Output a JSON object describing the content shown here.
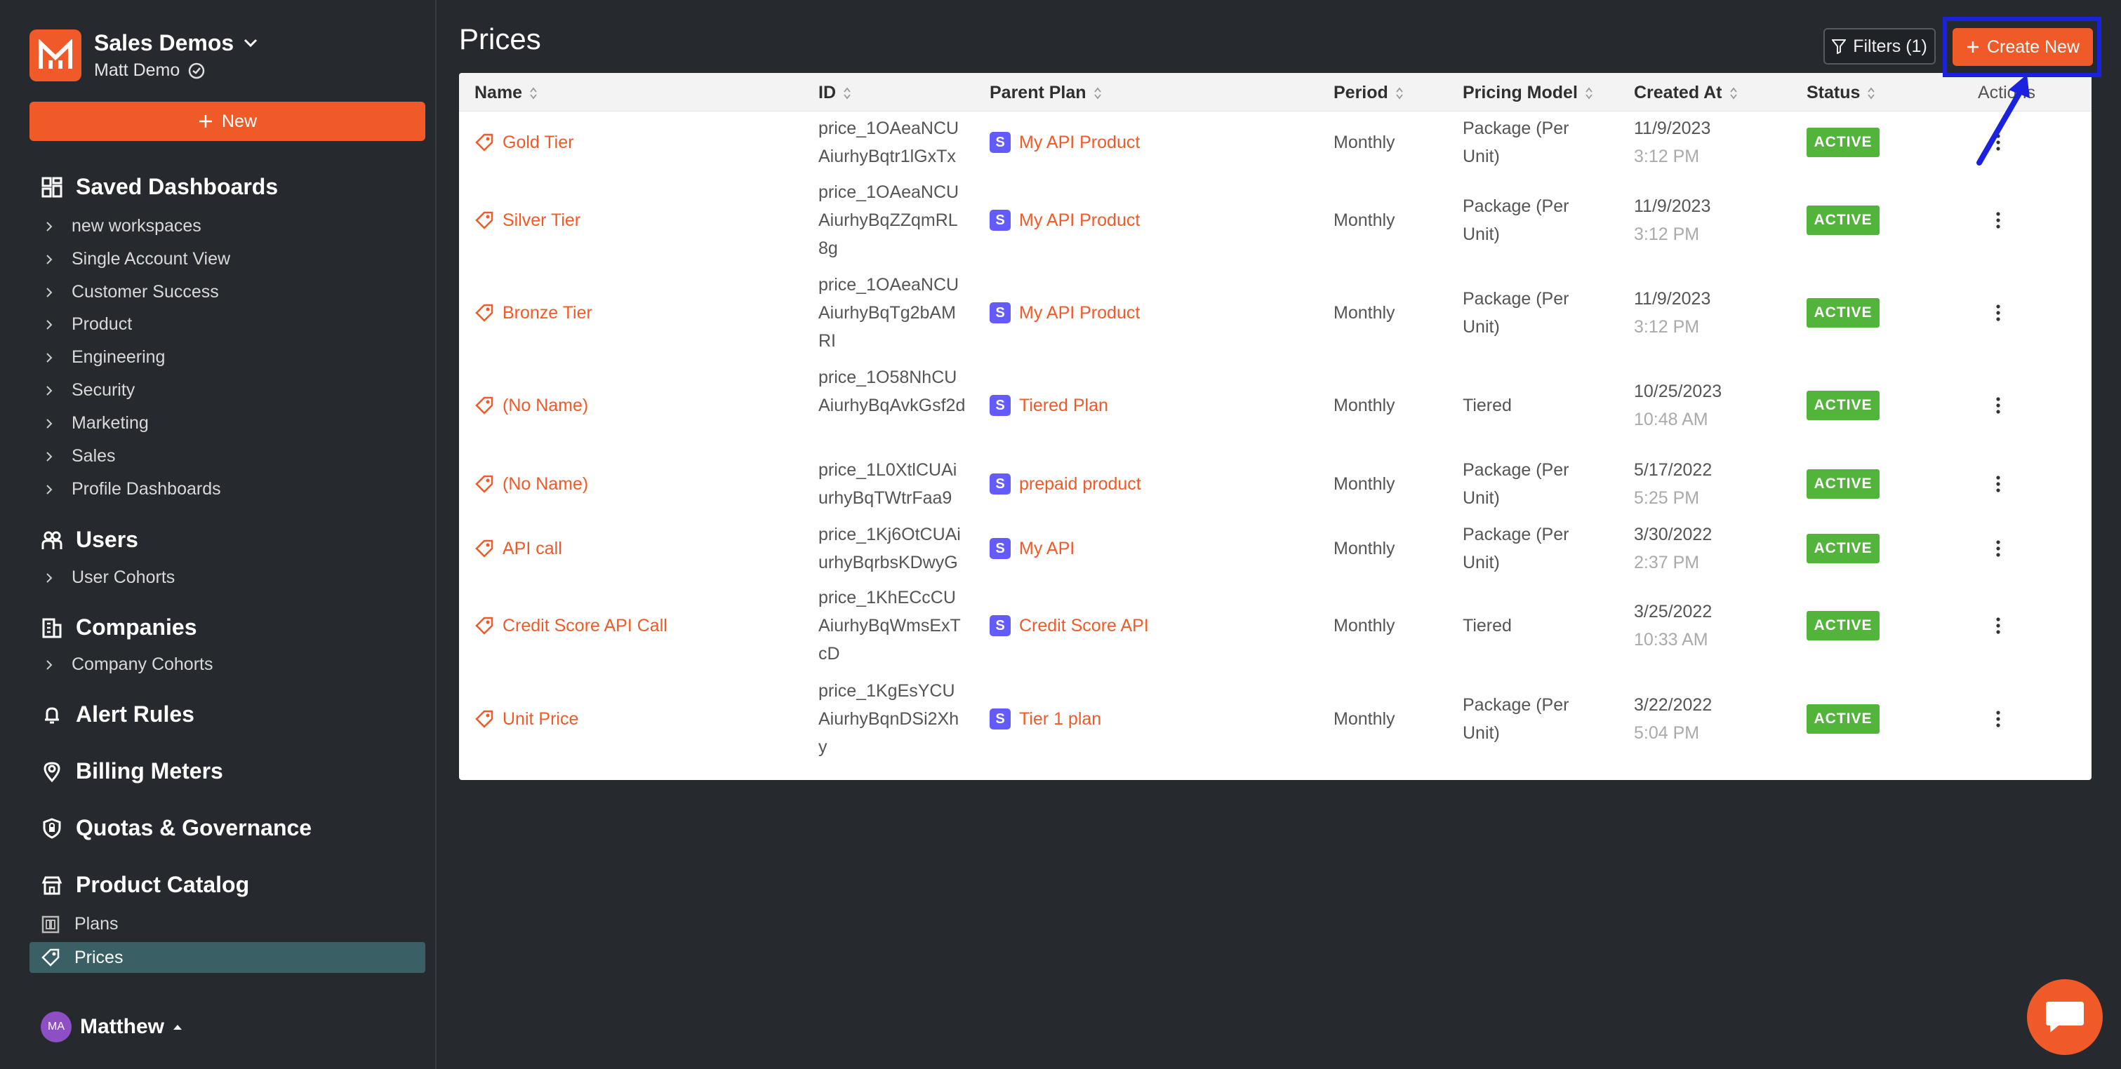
{
  "org": {
    "name": "Sales Demos",
    "user": "Matt Demo"
  },
  "sidebar": {
    "new_label": "New",
    "saved_dashboards": {
      "title": "Saved Dashboards",
      "items": [
        "new workspaces",
        "Single Account View",
        "Customer Success",
        "Product",
        "Engineering",
        "Security",
        "Marketing",
        "Sales",
        "Profile Dashboards"
      ]
    },
    "users": {
      "title": "Users",
      "items": [
        "User Cohorts"
      ]
    },
    "companies": {
      "title": "Companies",
      "items": [
        "Company Cohorts"
      ]
    },
    "alert_rules": "Alert Rules",
    "billing_meters": "Billing Meters",
    "quotas": "Quotas & Governance",
    "product_catalog": {
      "title": "Product Catalog",
      "plans": "Plans",
      "prices": "Prices"
    },
    "footer": {
      "initials": "MA",
      "name": "Matthew"
    }
  },
  "page": {
    "title": "Prices",
    "filters_label": "Filters (1)",
    "create_label": "Create New"
  },
  "table": {
    "columns": [
      "Name",
      "ID",
      "Parent Plan",
      "Period",
      "Pricing Model",
      "Created At",
      "Status",
      "Actions"
    ],
    "rows": [
      {
        "name": "Gold Tier",
        "id": "price_1OAeaNCUAiurhyBqtr1lGxTx",
        "plan": "My API Product",
        "period": "Monthly",
        "model": "Package (Per Unit)",
        "date": "11/9/2023",
        "time": "3:12 PM",
        "status": "ACTIVE"
      },
      {
        "name": "Silver Tier",
        "id": "price_1OAeaNCUAiurhyBqZZqmRL8g",
        "plan": "My API Product",
        "period": "Monthly",
        "model": "Package (Per Unit)",
        "date": "11/9/2023",
        "time": "3:12 PM",
        "status": "ACTIVE"
      },
      {
        "name": "Bronze Tier",
        "id": "price_1OAeaNCUAiurhyBqTg2bAMRI",
        "plan": "My API Product",
        "period": "Monthly",
        "model": "Package (Per Unit)",
        "date": "11/9/2023",
        "time": "3:12 PM",
        "status": "ACTIVE"
      },
      {
        "name": "(No Name)",
        "id": "price_1O58NhCUAiurhyBqAvkGsf2d",
        "plan": "Tiered Plan",
        "period": "Monthly",
        "model": "Tiered",
        "date": "10/25/2023",
        "time": "10:48 AM",
        "status": "ACTIVE"
      },
      {
        "name": "(No Name)",
        "id": "price_1L0XtlCUAiurhyBqTWtrFaa9",
        "plan": "prepaid product",
        "period": "Monthly",
        "model": "Package (Per Unit)",
        "date": "5/17/2022",
        "time": "5:25 PM",
        "status": "ACTIVE"
      },
      {
        "name": "API call",
        "id": "price_1Kj6OtCUAiurhyBqrbsKDwyG",
        "plan": "My API",
        "period": "Monthly",
        "model": "Package (Per Unit)",
        "date": "3/30/2022",
        "time": "2:37 PM",
        "status": "ACTIVE"
      },
      {
        "name": "Credit Score API Call",
        "id": "price_1KhECcCUAiurhyBqWmsExTcD",
        "plan": "Credit Score API",
        "period": "Monthly",
        "model": "Tiered",
        "date": "3/25/2022",
        "time": "10:33 AM",
        "status": "ACTIVE"
      },
      {
        "name": "Unit Price",
        "id": "price_1KgEsYCUAiurhyBqnDSi2Xhy",
        "plan": "Tier 1 plan",
        "period": "Monthly",
        "model": "Package (Per Unit)",
        "date": "3/22/2022",
        "time": "5:04 PM",
        "status": "ACTIVE"
      }
    ]
  },
  "colors": {
    "accent": "#f05a28",
    "active": "#52b43b",
    "stripe": "#635bff",
    "highlight": "#1a22e0"
  }
}
